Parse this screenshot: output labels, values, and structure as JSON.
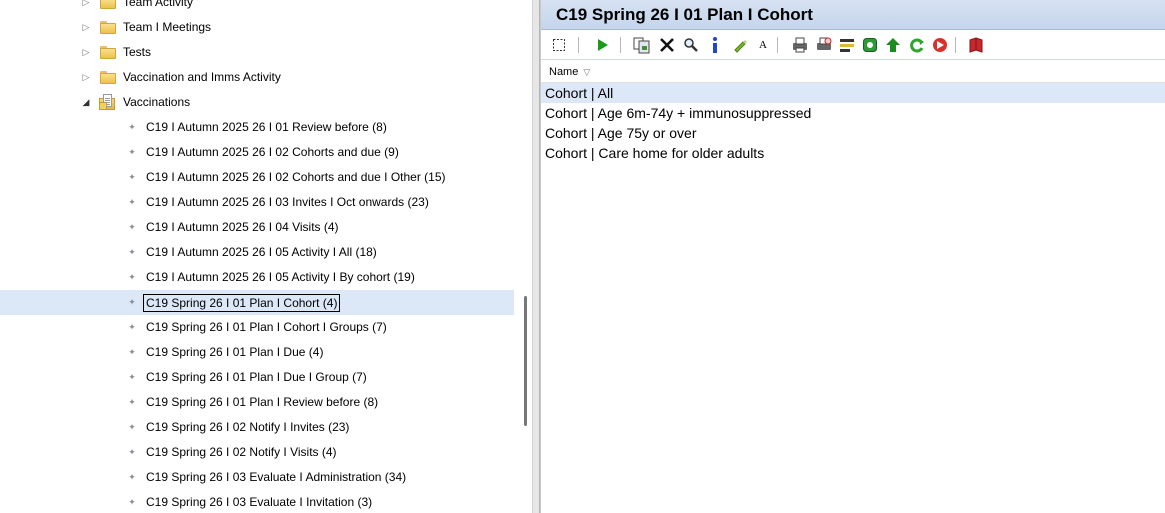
{
  "tree": {
    "folders": [
      {
        "label": "Team Activity"
      },
      {
        "label": "Team I Meetings"
      },
      {
        "label": "Tests"
      },
      {
        "label": "Vaccination and Imms Activity"
      }
    ],
    "open_folder": {
      "label": "Vaccinations"
    },
    "items": [
      {
        "label": "C19 I Autumn 2025 26 I 01 Review before (8)"
      },
      {
        "label": "C19 I Autumn 2025 26 I 02 Cohorts and due (9)"
      },
      {
        "label": "C19 I Autumn 2025 26 I 02 Cohorts and due I Other (15)"
      },
      {
        "label": "C19 I Autumn 2025 26 I 03 Invites I Oct onwards (23)"
      },
      {
        "label": "C19 I Autumn 2025 26 I 04 Visits (4)"
      },
      {
        "label": "C19 I Autumn 2025 26 I 05 Activity I All (18)"
      },
      {
        "label": "C19 I Autumn 2025 26 I 05 Activity I By cohort (19)"
      },
      {
        "label": "C19 Spring 26 I 01 Plan I Cohort (4)",
        "selected": true
      },
      {
        "label": "C19 Spring 26 I 01 Plan I Cohort I Groups (7)"
      },
      {
        "label": "C19 Spring 26 I 01 Plan I Due (4)"
      },
      {
        "label": "C19 Spring 26 I 01 Plan I Due I Group (7)"
      },
      {
        "label": "C19 Spring 26 I 01 Plan I Review before (8)"
      },
      {
        "label": "C19 Spring 26 I 02 Notify I Invites (23)"
      },
      {
        "label": "C19 Spring 26 I 02 Notify I Visits (4)"
      },
      {
        "label": "C19 Spring 26 I 03 Evaluate I Administration (34)"
      },
      {
        "label": "C19 Spring 26 I 03 Evaluate I Invitation (3)"
      }
    ]
  },
  "panel": {
    "title": "C19 Spring 26 I 01 Plan I Cohort",
    "column_header": "Name",
    "rows": [
      {
        "text": "Cohort |  All",
        "selected": true
      },
      {
        "text": "Cohort | Age 6m-74y + immunosuppressed"
      },
      {
        "text": "Cohort | Age 75y or over"
      },
      {
        "text": "Cohort | Care home for older adults"
      }
    ]
  },
  "toolbar": {
    "icons": [
      "select-icon",
      "run-icon",
      "copy-icon",
      "delete-icon",
      "search-icon",
      "info-icon",
      "edit-icon",
      "font-icon",
      "print-icon",
      "print-preview-icon",
      "report-icon",
      "export-icon",
      "move-up-icon",
      "refresh-icon",
      "next-icon",
      "book-icon"
    ],
    "colors": {
      "run": "#1a9c1a",
      "delete": "#111111",
      "info": "#2347c8",
      "edit": "#6aa51f",
      "up": "#1e8b1e",
      "refresh": "#2ea52e",
      "next": "#d9322b",
      "book": "#c8272b"
    }
  }
}
